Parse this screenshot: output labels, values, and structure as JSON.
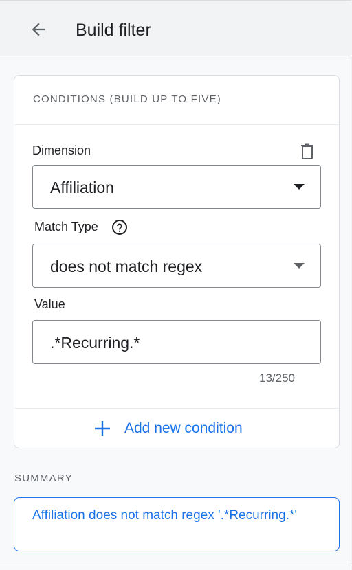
{
  "header": {
    "title": "Build filter",
    "back_icon": "arrow-back-icon"
  },
  "conditions": {
    "heading": "CONDITIONS (BUILD UP TO FIVE)",
    "dimension": {
      "label": "Dimension",
      "value": "Affiliation",
      "delete_icon": "trash-icon"
    },
    "match_type": {
      "label": "Match Type",
      "value": "does not match regex",
      "help_icon": "help-circle-icon"
    },
    "value_field": {
      "label": "Value",
      "value": ".*Recurring.*",
      "counter": "13/250"
    },
    "add_button": {
      "label": "Add new condition",
      "icon": "plus-icon"
    }
  },
  "summary": {
    "heading": "SUMMARY",
    "text": "Affiliation does not match regex '.*Recurring.*'"
  },
  "colors": {
    "accent": "#1a73e8",
    "text": "#202124",
    "muted": "#5f6368",
    "border": "#dadce0"
  }
}
